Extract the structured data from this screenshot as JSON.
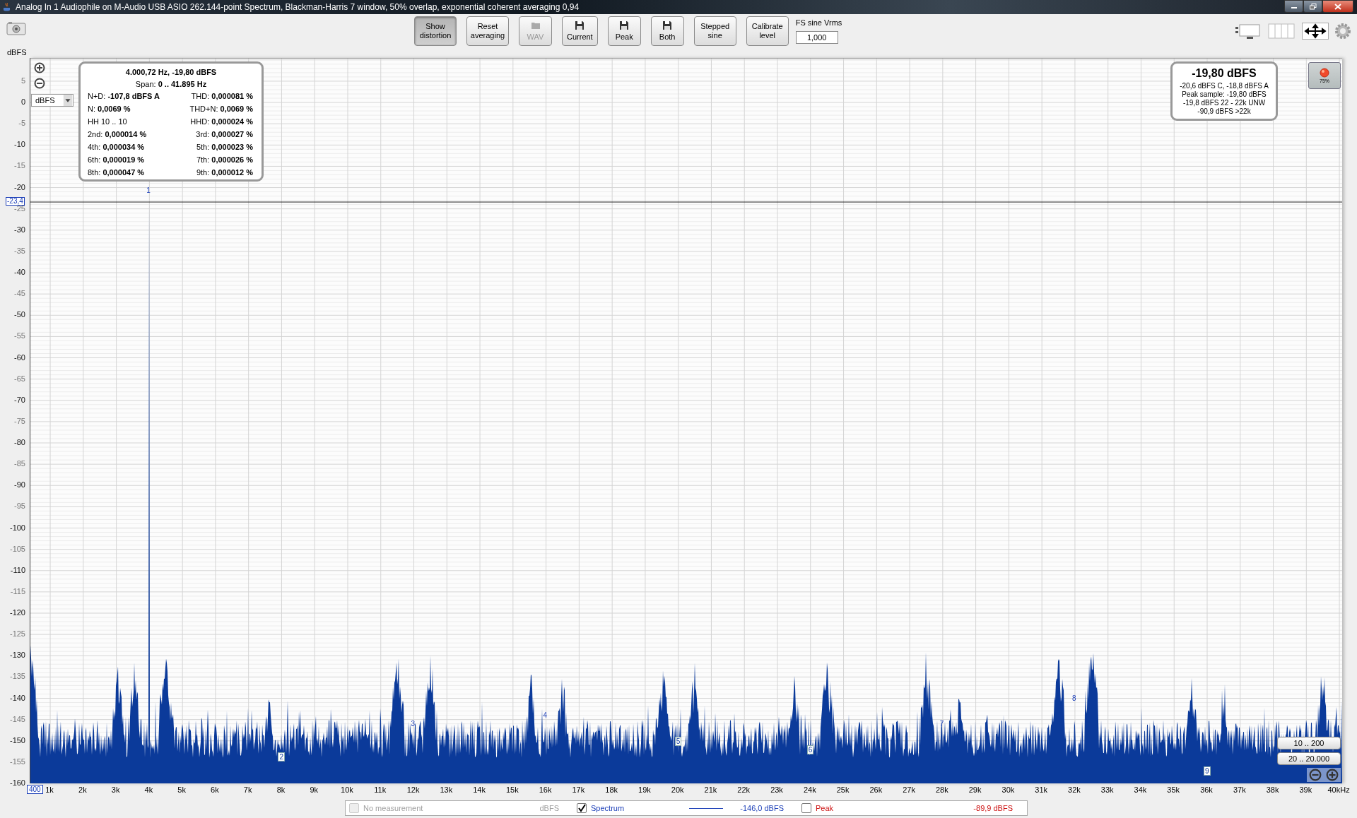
{
  "window": {
    "title": "Analog In 1 Audiophile on M-Audio USB ASIO 262.144-point Spectrum, Blackman-Harris 7 window, 50% overlap, exponential coherent averaging 0,94"
  },
  "toolbar": {
    "buttons": [
      {
        "label": "Show distortion",
        "kind": "text",
        "selected": true,
        "disabled": false
      },
      {
        "label": "Reset averaging",
        "kind": "text",
        "selected": false,
        "disabled": false
      },
      {
        "label": "WAV",
        "kind": "folder",
        "selected": false,
        "disabled": true
      },
      {
        "label": "Current",
        "kind": "disk",
        "selected": false,
        "disabled": false
      },
      {
        "label": "Peak",
        "kind": "disk",
        "selected": false,
        "disabled": false
      },
      {
        "label": "Both",
        "kind": "disk",
        "selected": false,
        "disabled": false
      },
      {
        "label": "Stepped sine",
        "kind": "text",
        "selected": false,
        "disabled": false
      },
      {
        "label": "Calibrate level",
        "kind": "text",
        "selected": false,
        "disabled": false
      }
    ],
    "fs_label": "FS sine Vrms",
    "fs_value": "1,000"
  },
  "y_axis": {
    "unit": "dBFS",
    "unit_selector": "dBFS",
    "cursor": "-23,4",
    "ticks": [
      "5",
      "0",
      "-5",
      "-10",
      "-15",
      "-20",
      "-25",
      "-30",
      "-35",
      "-40",
      "-45",
      "-50",
      "-55",
      "-60",
      "-65",
      "-70",
      "-75",
      "-80",
      "-85",
      "-90",
      "-95",
      "-100",
      "-105",
      "-110",
      "-115",
      "-120",
      "-125",
      "-130",
      "-135",
      "-140",
      "-145",
      "-150",
      "-155",
      "-160"
    ]
  },
  "x_axis": {
    "cursor": "400",
    "ticks": [
      "1k",
      "2k",
      "3k",
      "4k",
      "5k",
      "6k",
      "7k",
      "8k",
      "9k",
      "10k",
      "11k",
      "12k",
      "13k",
      "14k",
      "15k",
      "16k",
      "17k",
      "18k",
      "19k",
      "20k",
      "21k",
      "22k",
      "23k",
      "24k",
      "25k",
      "26k",
      "27k",
      "28k",
      "29k",
      "30k",
      "31k",
      "32k",
      "33k",
      "34k",
      "35k",
      "36k",
      "37k",
      "38k",
      "39k",
      "40kHz"
    ]
  },
  "distortion_panel": {
    "title": "4.000,72 Hz, -19,80 dBFS",
    "span": "Span: **0 .. 41.895 Hz**",
    "cells": [
      "N+D: **-107,8 dBFS A**",
      "THD: **0,000081 %**",
      "N: **0,0069 %**",
      "THD+N: **0,0069 %**",
      "HH 10 .. 10",
      "HHD: **0,000024 %**",
      "2nd: **0,000014 %**",
      "3rd: **0,000027 %**",
      "4th: **0,000034 %**",
      "5th: **0,000023 %**",
      "6th: **0,000019 %**",
      "7th: **0,000026 %**",
      "8th: **0,000047 %**",
      "9th: **0,000012 %**"
    ]
  },
  "level_readout": {
    "main": "-19,80 dBFS",
    "lines": [
      "-20,6 dBFS C, -18,8 dBFS A",
      "Peak sample: -19,80 dBFS",
      "-19,8 dBFS 22 - 22k UNW",
      "-90,9 dBFS >22k"
    ]
  },
  "input_level": {
    "label": "75%"
  },
  "harmonic_markers": [
    {
      "label": "1",
      "boxed": false
    },
    {
      "label": "2",
      "boxed": true
    },
    {
      "label": "3",
      "boxed": false
    },
    {
      "label": "4",
      "boxed": false
    },
    {
      "label": "5",
      "boxed": true
    },
    {
      "label": "6",
      "boxed": true
    },
    {
      "label": "7",
      "boxed": false
    },
    {
      "label": "8",
      "boxed": false
    },
    {
      "label": "9",
      "boxed": true
    }
  ],
  "range_buttons": [
    "10 .. 200",
    "20 .. 20.000"
  ],
  "legend": [
    {
      "label": "No measurement",
      "value": "dBFS",
      "checked": false,
      "disabled": true,
      "show_line": false,
      "color": "#a0a0a0"
    },
    {
      "label": "Spectrum",
      "value": "-146,0 dBFS",
      "checked": true,
      "disabled": false,
      "show_line": true,
      "color": "#1c3fb8"
    },
    {
      "label": "Peak",
      "value": "-89,9 dBFS",
      "checked": false,
      "disabled": false,
      "show_line": false,
      "color": "#cc1010"
    }
  ]
}
